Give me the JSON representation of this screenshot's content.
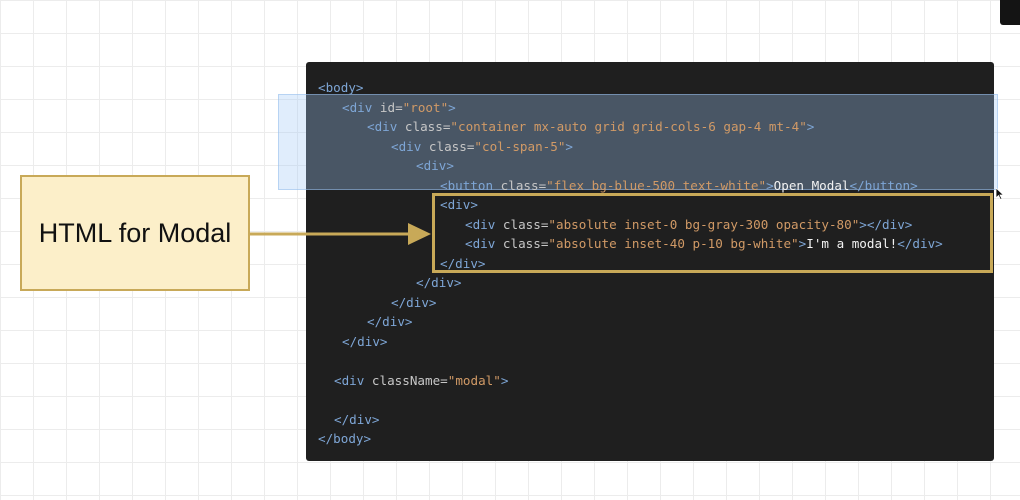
{
  "label": {
    "text": "HTML for Modal"
  },
  "code_lines": [
    [
      {
        "c": "tag",
        "t": "<body>"
      }
    ],
    [
      {
        "c": "tag",
        "t": "<div "
      },
      {
        "c": "attr",
        "t": "id="
      },
      {
        "c": "val",
        "t": "\"root\""
      },
      {
        "c": "tag",
        "t": ">"
      }
    ],
    [
      {
        "c": "tag",
        "t": "<div "
      },
      {
        "c": "attr",
        "t": "class="
      },
      {
        "c": "val",
        "t": "\"container mx-auto grid grid-cols-6 gap-4 mt-4\""
      },
      {
        "c": "tag",
        "t": ">"
      }
    ],
    [
      {
        "c": "tag",
        "t": "<div "
      },
      {
        "c": "attr",
        "t": "class="
      },
      {
        "c": "val",
        "t": "\"col-span-5\""
      },
      {
        "c": "tag",
        "t": ">"
      }
    ],
    [
      {
        "c": "tag",
        "t": "<div>"
      }
    ],
    [
      {
        "c": "tag",
        "t": "<button "
      },
      {
        "c": "attr",
        "t": "class="
      },
      {
        "c": "val",
        "t": "\"flex bg-blue-500 text-white\""
      },
      {
        "c": "tag",
        "t": ">"
      },
      {
        "c": "txt",
        "t": "Open Modal"
      },
      {
        "c": "tag",
        "t": "</button>"
      }
    ],
    [
      {
        "c": "tag",
        "t": "<div>"
      }
    ],
    [
      {
        "c": "tag",
        "t": "<div "
      },
      {
        "c": "attr",
        "t": "class="
      },
      {
        "c": "val",
        "t": "\"absolute inset-0 bg-gray-300 opacity-80\""
      },
      {
        "c": "tag",
        "t": "></div>"
      }
    ],
    [
      {
        "c": "tag",
        "t": "<div "
      },
      {
        "c": "attr",
        "t": "class="
      },
      {
        "c": "val",
        "t": "\"absolute inset-40 p-10 bg-white\""
      },
      {
        "c": "tag",
        "t": ">"
      },
      {
        "c": "txt",
        "t": "I'm a modal!"
      },
      {
        "c": "tag",
        "t": "</div>"
      }
    ],
    [
      {
        "c": "tag",
        "t": "</div>"
      }
    ],
    [
      {
        "c": "tag",
        "t": "</div>"
      }
    ],
    [
      {
        "c": "tag",
        "t": "</div>"
      }
    ],
    [
      {
        "c": "tag",
        "t": "</div>"
      }
    ],
    [
      {
        "c": "tag",
        "t": "</div>"
      }
    ],
    [],
    [
      {
        "c": "tag",
        "t": "<div "
      },
      {
        "c": "attr",
        "t": "className="
      },
      {
        "c": "val",
        "t": "\"modal\""
      },
      {
        "c": "tag",
        "t": ">"
      }
    ],
    [],
    [
      {
        "c": "tag",
        "t": "</div>"
      }
    ],
    [
      {
        "c": "tag",
        "t": "</body>"
      }
    ]
  ],
  "colors": {
    "highlight": "#c8a958",
    "label_fill": "#fcefc9",
    "panel": "#1f1f1f"
  },
  "icons": {
    "pointer": "mouse-cursor-icon",
    "arrow": "arrow-right-icon"
  }
}
